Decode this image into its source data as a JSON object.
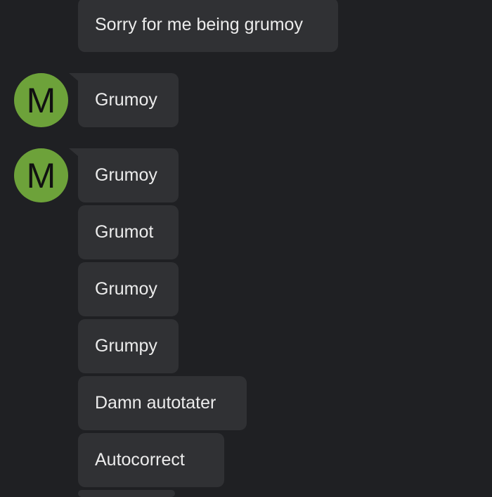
{
  "conversation": {
    "sender_initial": "M",
    "colors": {
      "background": "#1f2023",
      "bubble": "#303134",
      "avatar": "#6da23a",
      "text": "#ececec"
    },
    "messages": [
      {
        "text": "Sorry for me being grumoy"
      },
      {
        "text": "Grumoy"
      },
      {
        "text": "Grumoy"
      },
      {
        "text": "Grumot"
      },
      {
        "text": "Grumoy"
      },
      {
        "text": "Grumpy"
      },
      {
        "text": "Damn autotater"
      },
      {
        "text": "Autocorrect"
      }
    ]
  }
}
